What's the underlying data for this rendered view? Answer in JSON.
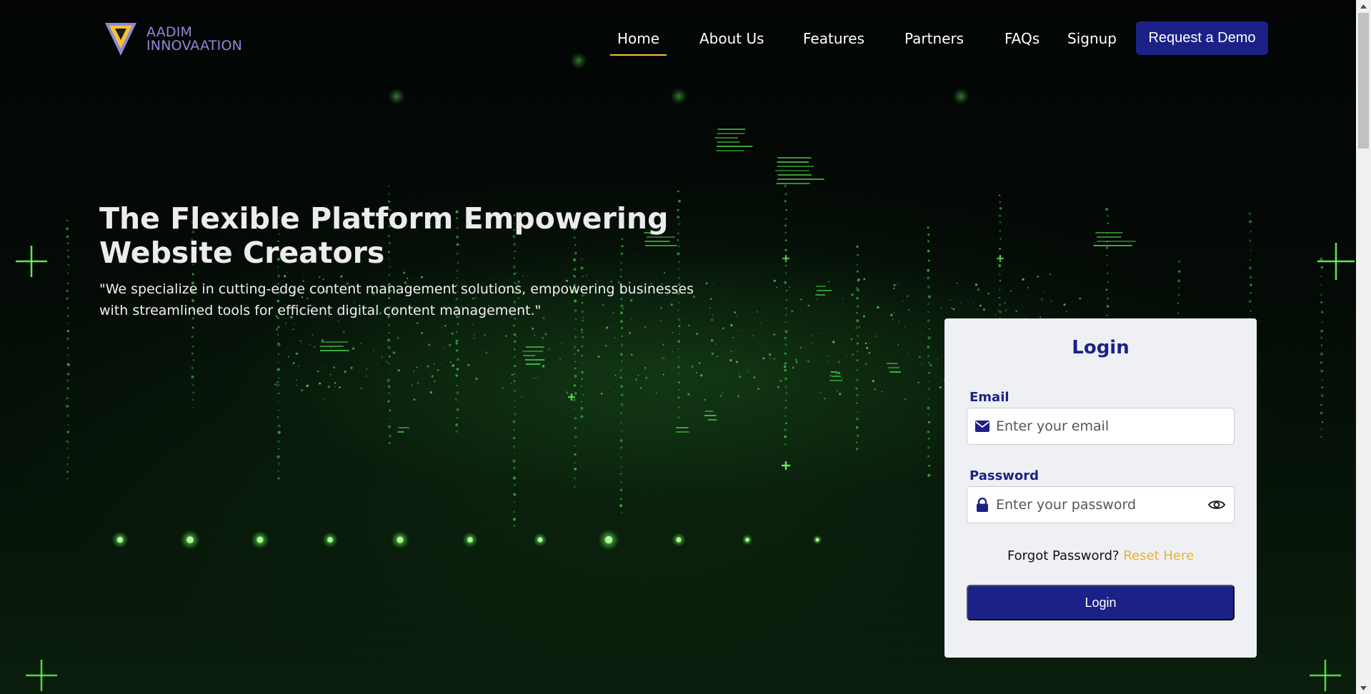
{
  "brand": {
    "line1": "AADIM",
    "line2": "INNOVAATION",
    "logo_icon": "aadim-logo-icon"
  },
  "nav": {
    "items": [
      {
        "label": "Home",
        "active": true
      },
      {
        "label": "About Us",
        "active": false
      },
      {
        "label": "Features",
        "active": false
      },
      {
        "label": "Partners",
        "active": false
      },
      {
        "label": "FAQs",
        "active": false
      },
      {
        "label": "Signup",
        "active": false
      }
    ],
    "cta_label": "Request a Demo"
  },
  "hero": {
    "title": "The Flexible Platform Empowering Website Creators",
    "subtitle": "\"We specialize in cutting-edge content management solutions, empowering businesses with streamlined tools for efficient digital content management.\""
  },
  "login": {
    "title": "Login",
    "email_label": "Email",
    "email_placeholder": "Enter your email",
    "email_icon": "envelope-icon",
    "password_label": "Password",
    "password_placeholder": "Enter your password",
    "password_icon": "lock-icon",
    "toggle_icon": "eye-icon",
    "forgot_text": "Forgot Password?",
    "reset_link": "Reset Here",
    "submit_label": "Login"
  },
  "colors": {
    "accent": "#1c2187",
    "highlight": "#f5c332",
    "link": "#e8b530",
    "background": "#05090a"
  }
}
